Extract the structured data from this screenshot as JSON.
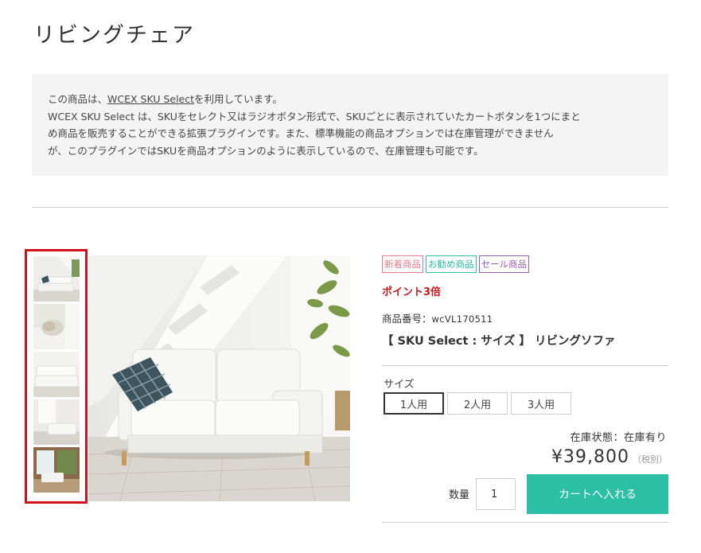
{
  "page": {
    "title": "リビングチェア"
  },
  "notice": {
    "prefix": "この商品は、",
    "link": "WCEX SKU Select",
    "suffix": "を利用しています。",
    "body_line1": "WCEX SKU Select は、SKUをセレクト又はラジオボタン形式で、SKUごとに表示されていたカートボタンを1つにまと",
    "body_line2": "め商品を販売することができる拡張プラグインです。また、標準機能の商品オプションでは在庫管理ができません",
    "body_line3": "が、このプラグインではSKUを商品オプションのように表示しているので、在庫管理も可能です。"
  },
  "badges": [
    {
      "label": "新着商品",
      "color": "#e07a8a"
    },
    {
      "label": "お勧め商品",
      "color": "#2bbfa6"
    },
    {
      "label": "セール商品",
      "color": "#9a5fb0"
    }
  ],
  "product": {
    "points": "ポイント3倍",
    "code_label": "商品番号：",
    "code": "wcVL170511",
    "name": "【 SKU Select : サイズ 】 リビングソファ"
  },
  "size": {
    "label": "サイズ",
    "options": [
      "1人用",
      "2人用",
      "3人用"
    ],
    "selected": "1人用"
  },
  "stock": "在庫状態：在庫有り",
  "price": {
    "amount": "¥39,800",
    "tax": "（税別）"
  },
  "qty": {
    "label": "数量",
    "value": "1"
  },
  "cart": {
    "label": "カートへ入れる",
    "color": "#2bbfa6"
  },
  "thumbnails": [
    "sofa-thumb",
    "cushion-thumb",
    "sofa-front-thumb",
    "room-thumb",
    "window-room-thumb"
  ]
}
